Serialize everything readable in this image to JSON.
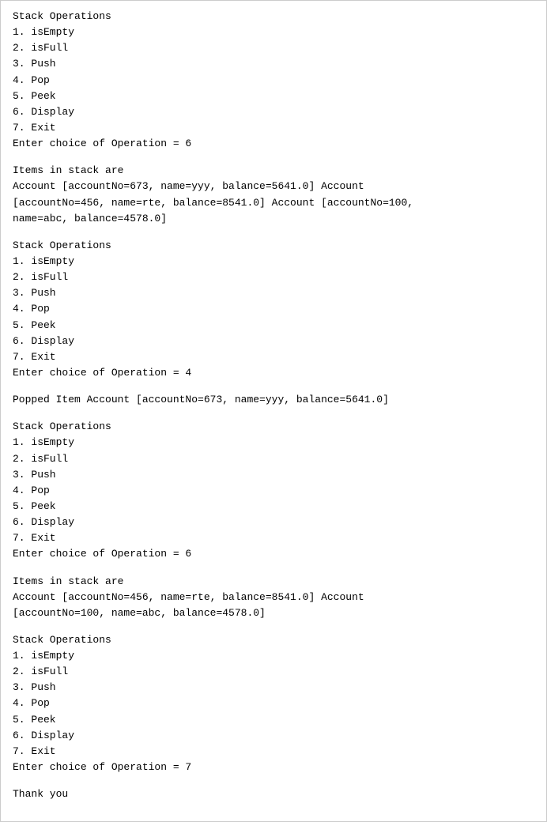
{
  "terminal": {
    "blocks": [
      {
        "id": "block1",
        "lines": [
          "Stack Operations",
          "1. isEmpty",
          "2. isFull",
          "3. Push",
          "4. Pop",
          "5. Peek",
          "6. Display",
          "7. Exit",
          "Enter choice of Operation = 6"
        ]
      },
      {
        "id": "block2",
        "lines": [
          "Items in stack are",
          "Account [accountNo=673, name=yyy, balance=5641.0] Account",
          "[accountNo=456, name=rte, balance=8541.0] Account [accountNo=100,",
          "name=abc, balance=4578.0]"
        ]
      },
      {
        "id": "block3",
        "lines": [
          "Stack Operations",
          "1. isEmpty",
          "2. isFull",
          "3. Push",
          "4. Pop",
          "5. Peek",
          "6. Display",
          "7. Exit",
          "Enter choice of Operation = 4"
        ]
      },
      {
        "id": "block4",
        "lines": [
          "Popped Item Account [accountNo=673, name=yyy, balance=5641.0]"
        ]
      },
      {
        "id": "block5",
        "lines": [
          "Stack Operations",
          "1. isEmpty",
          "2. isFull",
          "3. Push",
          "4. Pop",
          "5. Peek",
          "6. Display",
          "7. Exit",
          "Enter choice of Operation = 6"
        ]
      },
      {
        "id": "block6",
        "lines": [
          "Items in stack are",
          "Account [accountNo=456, name=rte, balance=8541.0] Account",
          "[accountNo=100, name=abc, balance=4578.0]"
        ]
      },
      {
        "id": "block7",
        "lines": [
          "Stack Operations",
          "1. isEmpty",
          "2. isFull",
          "3. Push",
          "4. Pop",
          "5. Peek",
          "6. Display",
          "7. Exit",
          "Enter choice of Operation = 7"
        ]
      },
      {
        "id": "block8",
        "lines": [
          "Thank you"
        ]
      }
    ]
  }
}
